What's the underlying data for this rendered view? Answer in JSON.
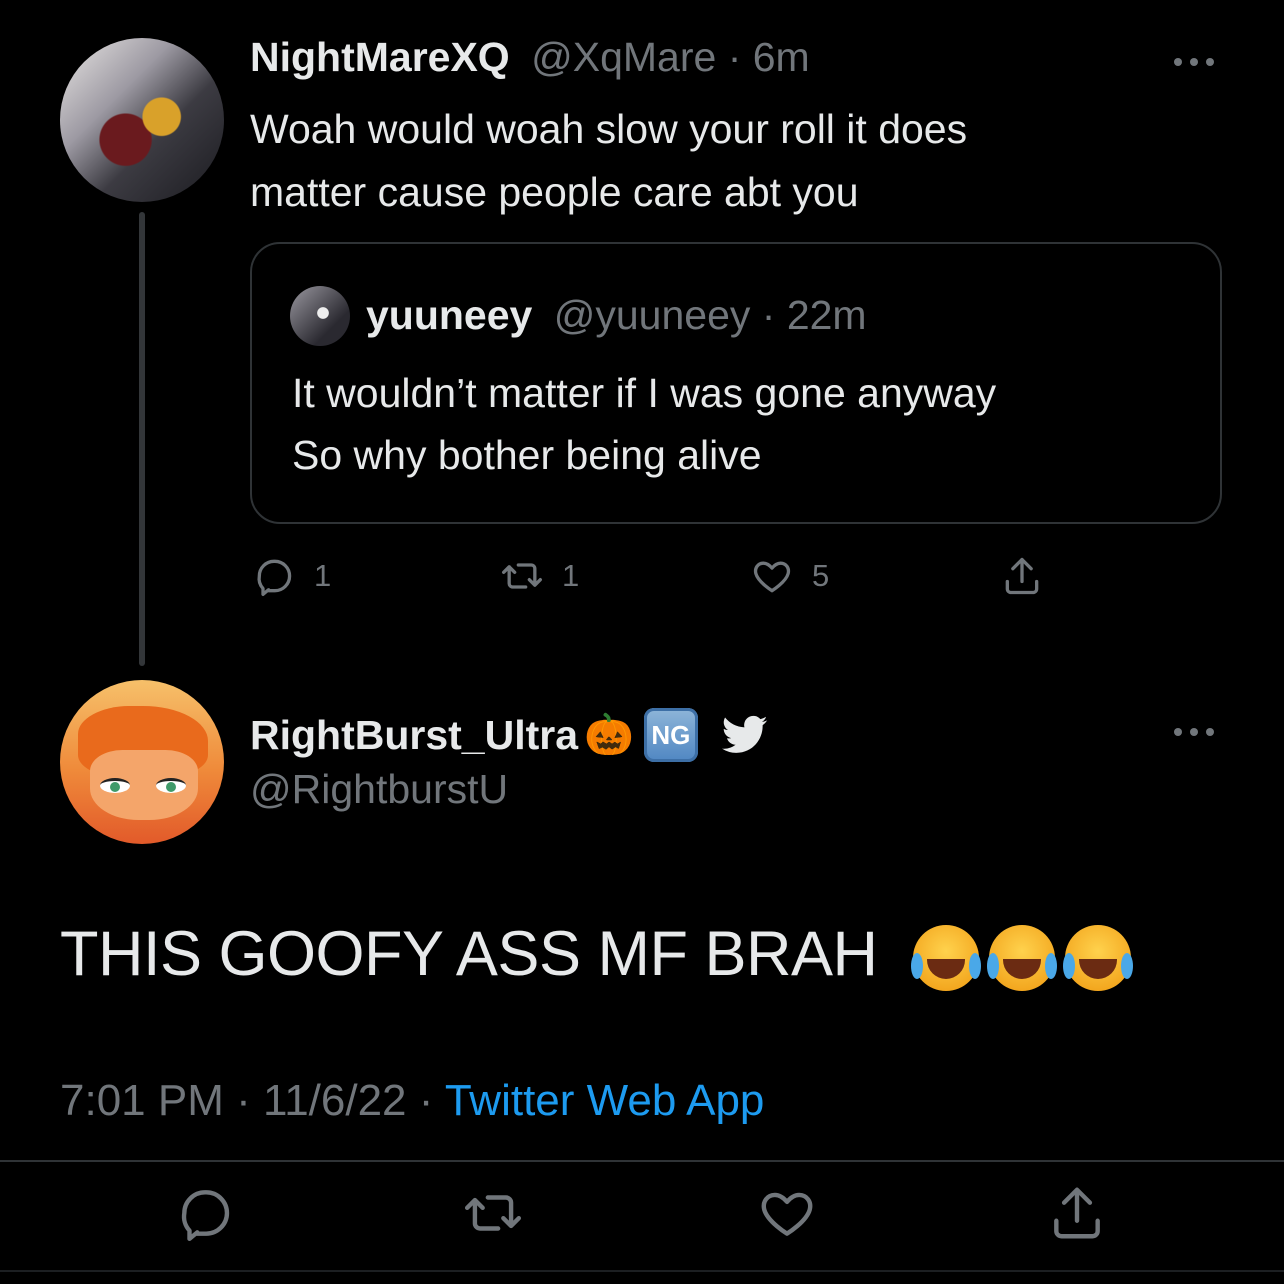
{
  "reply_tweet": {
    "display_name": "NightMareXQ",
    "handle": "@XqMare",
    "time": "6m",
    "text_line1": "Woah would woah slow your roll it does",
    "text_line2": "matter cause people care abt you",
    "more_icon": "more-horizontal-icon",
    "quoted": {
      "display_name": "yuuneey",
      "handle": "@yuuneey",
      "time": "22m",
      "text_line1": "It wouldn’t matter if I was gone anyway",
      "text_line2": "So why bother being alive"
    },
    "actions": {
      "reply_count": "1",
      "retweet_count": "1",
      "like_count": "5"
    }
  },
  "main_tweet": {
    "display_name": "RightBurst_Ultra",
    "name_emoji": "🎃",
    "badge_text": "NG",
    "handle": "@RightburstU",
    "text": "THIS GOOFY ASS MF BRAH",
    "trailing_emoji": [
      "😂",
      "😂",
      "😂"
    ],
    "time": "7:01 PM",
    "date": "11/6/22",
    "source": "Twitter Web App",
    "more_icon": "more-horizontal-icon"
  },
  "colors": {
    "background": "#000000",
    "text": "#e7e9ea",
    "muted": "#71767b",
    "accent": "#1d9bf0",
    "border": "#2f3336"
  }
}
